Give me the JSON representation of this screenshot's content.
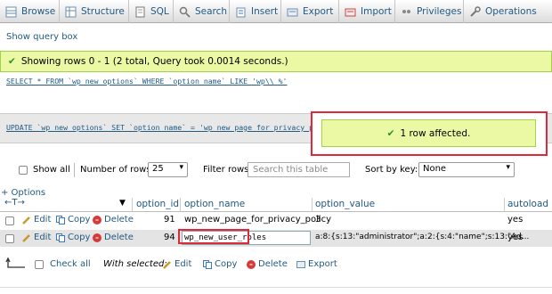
{
  "tabs": [
    {
      "label": "Browse",
      "icon": "browse-icon"
    },
    {
      "label": "Structure",
      "icon": "structure-icon"
    },
    {
      "label": "SQL",
      "icon": "sql-icon"
    },
    {
      "label": "Search",
      "icon": "search-icon"
    },
    {
      "label": "Insert",
      "icon": "insert-icon"
    },
    {
      "label": "Export",
      "icon": "export-icon"
    },
    {
      "label": "Import",
      "icon": "import-icon"
    },
    {
      "label": "Privileges",
      "icon": "privileges-icon"
    },
    {
      "label": "Operations",
      "icon": "operations-icon"
    }
  ],
  "show_query_box": "Show query box",
  "success_message": "Showing rows 0 - 1 (2 total, Query took 0.0014 seconds.)",
  "sql_query": "SELECT * FROM `wp_new_options` WHERE `option_name` LIKE 'wp\\\\_%'",
  "update_query": "UPDATE `wp_new_options` SET `option_name` = 'wp_new_page_for_privacy_policy' WHERE `",
  "affected_message": "1 row affected.",
  "controls": {
    "show_all": "Show all",
    "number_of_rows_label": "Number of rows:",
    "number_of_rows_value": "25",
    "filter_rows_label": "Filter rows:",
    "filter_placeholder": "Search this table",
    "sort_by_key_label": "Sort by key:",
    "sort_by_key_value": "None"
  },
  "options_link": "+ Options",
  "table": {
    "columns": [
      "option_id",
      "option_name",
      "option_value",
      "autoload"
    ],
    "rows": [
      {
        "option_id": "91",
        "option_name": "wp_new_page_for_privacy_policy",
        "option_value": "3",
        "autoload": "yes"
      },
      {
        "option_id": "94",
        "option_name": "wp_new_user_roles",
        "option_value": "a:8:{s:13:\"administrator\";a:2:{s:4:\"name\";s:13:\"Ad...",
        "autoload": "yes"
      }
    ],
    "row_actions": {
      "edit": "Edit",
      "copy": "Copy",
      "delete": "Delete"
    }
  },
  "bottom": {
    "check_all": "Check all",
    "with_selected": "With selected:",
    "edit": "Edit",
    "copy": "Copy",
    "delete": "Delete",
    "export": "Export"
  },
  "colors": {
    "link": "#235a81",
    "success_bg": "#ebf8a4",
    "highlight_border": "#e0283a"
  }
}
